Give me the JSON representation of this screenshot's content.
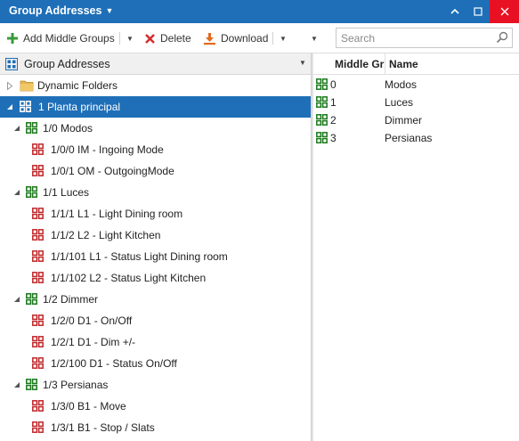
{
  "title_bar": {
    "title": "Group Addresses"
  },
  "toolbar": {
    "add_middle_groups": "Add Middle Groups",
    "delete": "Delete",
    "download": "Download",
    "search_placeholder": "Search"
  },
  "colors": {
    "accent": "#1e6fb8",
    "close": "#e81123",
    "middle_group_icon": "#1a7a1a",
    "group_address_icon": "#c0282a",
    "main_group_icon": "#1e6fb8",
    "folder": "#e8b44c"
  },
  "left_pane": {
    "header": "Group Addresses",
    "tree": [
      {
        "label": "Dynamic Folders",
        "level": 0,
        "icon": "folder-icon",
        "expander": "collapsed"
      },
      {
        "label": "1 Planta principal",
        "level": 0,
        "icon": "main-group-icon",
        "expander": "expanded",
        "selected": true
      },
      {
        "label": "1/0 Modos",
        "level": 1,
        "icon": "middle-group-icon",
        "expander": "expanded"
      },
      {
        "label": "1/0/0 IM - Ingoing Mode",
        "level": 2,
        "icon": "group-address-icon"
      },
      {
        "label": "1/0/1 OM - OutgoingMode",
        "level": 2,
        "icon": "group-address-icon"
      },
      {
        "label": "1/1 Luces",
        "level": 1,
        "icon": "middle-group-icon",
        "expander": "expanded"
      },
      {
        "label": "1/1/1 L1 - Light Dining room",
        "level": 2,
        "icon": "group-address-icon"
      },
      {
        "label": "1/1/2 L2 - Light Kitchen",
        "level": 2,
        "icon": "group-address-icon"
      },
      {
        "label": "1/1/101 L1 - Status Light Dining room",
        "level": 2,
        "icon": "group-address-icon"
      },
      {
        "label": "1/1/102 L2 - Status Light Kitchen",
        "level": 2,
        "icon": "group-address-icon"
      },
      {
        "label": "1/2 Dimmer",
        "level": 1,
        "icon": "middle-group-icon",
        "expander": "expanded"
      },
      {
        "label": "1/2/0 D1 - On/Off",
        "level": 2,
        "icon": "group-address-icon"
      },
      {
        "label": "1/2/1 D1 - Dim +/-",
        "level": 2,
        "icon": "group-address-icon"
      },
      {
        "label": "1/2/100 D1 - Status On/Off",
        "level": 2,
        "icon": "group-address-icon"
      },
      {
        "label": "1/3 Persianas",
        "level": 1,
        "icon": "middle-group-icon",
        "expander": "expanded"
      },
      {
        "label": "1/3/0 B1 - Move",
        "level": 2,
        "icon": "group-address-icon"
      },
      {
        "label": "1/3/1 B1 - Stop / Slats",
        "level": 2,
        "icon": "group-address-icon"
      }
    ]
  },
  "right_pane": {
    "columns": [
      "Middle Gr",
      "Name"
    ],
    "rows": [
      {
        "middle_group": "0",
        "name": "Modos"
      },
      {
        "middle_group": "1",
        "name": "Luces"
      },
      {
        "middle_group": "2",
        "name": "Dimmer"
      },
      {
        "middle_group": "3",
        "name": "Persianas"
      }
    ]
  }
}
